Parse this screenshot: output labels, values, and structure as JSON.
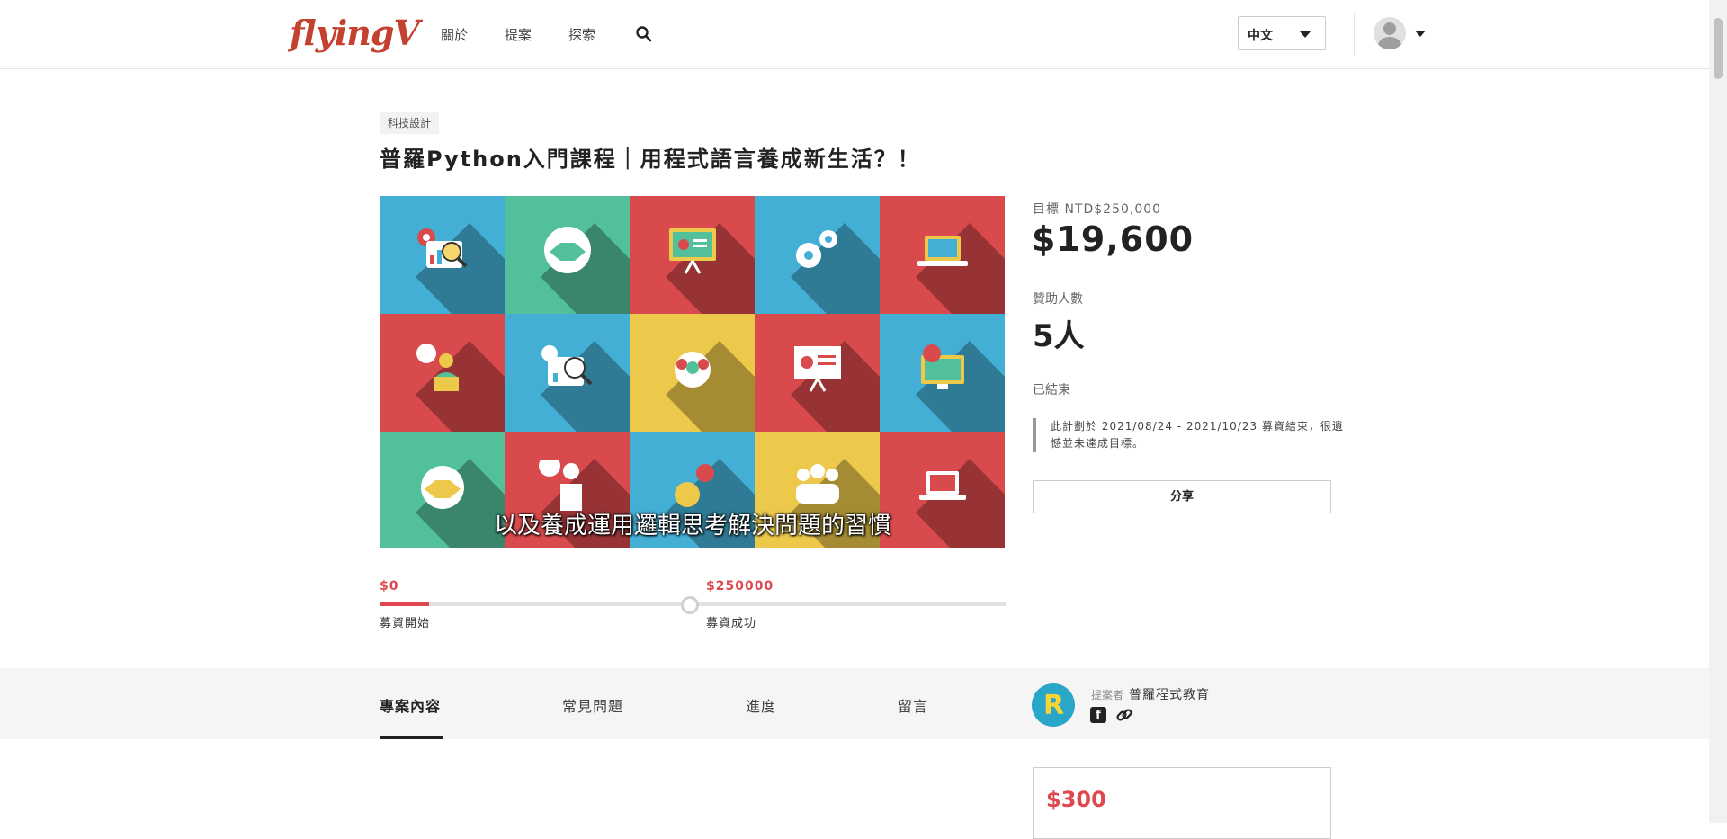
{
  "header": {
    "logo": "flyingV",
    "nav": [
      {
        "label": "關於"
      },
      {
        "label": "提案"
      },
      {
        "label": "探索"
      }
    ],
    "language": "中文"
  },
  "project": {
    "category": "科技設計",
    "title": "普羅Python入門課程｜用程式語言養成新生活？！",
    "video_subtitle": "以及養成運用邏輯思考解決問題的習慣"
  },
  "stats": {
    "goal_label": "目標 NTD$250,000",
    "raised": "$19,600",
    "backers_label": "贊助人數",
    "backers": "5人",
    "status": "已結束",
    "note": "此計劃於 2021/08/24 - 2021/10/23 募資結束，很遺憾並未達成目標。",
    "share_label": "分享"
  },
  "progress": {
    "start_amount": "$0",
    "start_label": "募資開始",
    "goal_amount": "$250000",
    "goal_label": "募資成功",
    "fraction": 0.0784
  },
  "tabs": [
    {
      "label": "專案內容",
      "active": true
    },
    {
      "label": "常見問題",
      "active": false
    },
    {
      "label": "進度",
      "active": false
    },
    {
      "label": "留言",
      "active": false
    }
  ],
  "owner": {
    "label": "提案者",
    "name": "普羅程式教育",
    "logo_letter": "R"
  },
  "reward": {
    "amount": "$300"
  },
  "colors": {
    "brand": "#c4412f",
    "accent": "#e0484f",
    "tile_blue": "#44afd5",
    "tile_green": "#52c19b",
    "tile_red": "#d94a4d",
    "tile_yellow": "#ecc94b"
  }
}
